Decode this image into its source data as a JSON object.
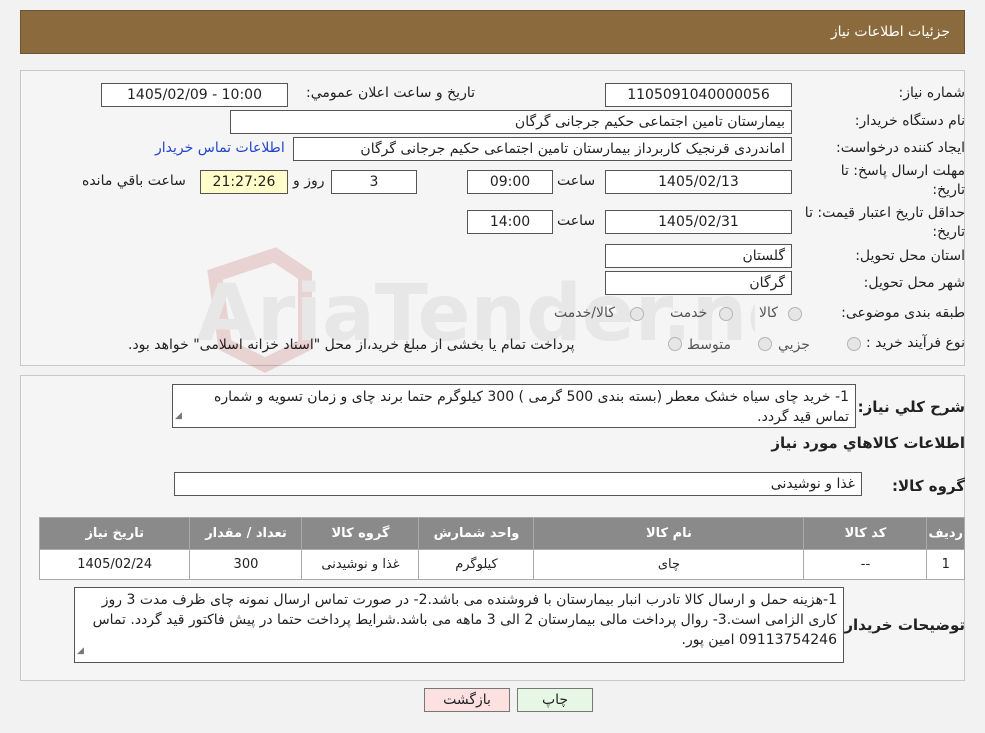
{
  "header": {
    "title": "جزئیات اطلاعات نیاز"
  },
  "watermark": {
    "text": "AriaTender.neT"
  },
  "form": {
    "need_number_label": "شماره نیاز:",
    "need_number": "1105091040000056",
    "announce_label": "تاریخ و ساعت اعلان عمومي:",
    "announce_value": "1405/02/09 - 10:00",
    "buyer_org_label": "نام دستگاه خریدار:",
    "buyer_org": "بیمارستان تامین اجتماعی حکیم جرجانی گرگان",
    "creator_label": "ایجاد کننده درخواست:",
    "creator": "اماندردی قرنجیک کاربرداز بیمارستان تامین اجتماعی حکیم جرجانی گرگان",
    "contact_link": "اطلاعات تماس خریدار",
    "reply_deadline_label_1": "مهلت ارسال پاسخ: تا",
    "reply_deadline_label_2": "تاریخ:",
    "reply_date": "1405/02/13",
    "time_label": "ساعت",
    "reply_time": "09:00",
    "days_value": "3",
    "days_label": "روز و",
    "remaining_time": "21:27:26",
    "remaining_label": "ساعت باقي مانده",
    "price_validity_label_1": "حداقل تاریخ اعتبار قیمت: تا",
    "price_validity_label_2": "تاریخ:",
    "price_date": "1405/02/31",
    "price_time": "14:00",
    "province_label": "استان محل تحویل:",
    "province": "گلستان",
    "city_label": "شهر محل تحویل:",
    "city": "گرگان",
    "category_label": "طبقه بندی موضوعی:",
    "category_options": [
      "کالا",
      "خدمت",
      "کالا/خدمت"
    ],
    "process_label": "نوع فرآیند خرید :",
    "process_options": [
      "جزیي",
      "متوسط"
    ],
    "process_note": "پرداخت تمام یا بخشی از مبلغ خرید،از محل \"اسناد خزانه اسلامی\" خواهد بود."
  },
  "summary": {
    "label": "شرح کلي نیاز:",
    "text": "1- خرید چای سیاه خشک معطر (بسته بندی 500 گرمی )    300 کیلوگرم  حتما برند چای و زمان تسویه و شماره تماس قید گردد.",
    "items_title": "اطلاعات کالاهاي مورد نیاز",
    "group_label": "گروه کالا:",
    "group_value": "غذا و نوشیدنی"
  },
  "table": {
    "headers": [
      "ردیف",
      "کد کالا",
      "نام کالا",
      "واحد شمارش",
      "گروه کالا",
      "تعداد / مقدار",
      "تاریخ نیاز"
    ],
    "rows": [
      [
        "1",
        "--",
        "چای",
        "کیلوگرم",
        "غذا و نوشیدنی",
        "300",
        "1405/02/24"
      ]
    ]
  },
  "buyer_notes": {
    "label": "توضیحات خریدار:",
    "text": "1-هزینه حمل و ارسال کالا تادرب انبار بیمارستان با فروشنده می باشد.2- در صورت تماس ارسال نمونه چای ظرف مدت 3 روز کاری الزامی است.3- روال پرداخت مالی بیمارستان 2 الی 3 ماهه می باشد.شرایط پرداخت حتما در پیش فاکتور قید گردد. تماس 09113754246 امین پور."
  },
  "buttons": {
    "print": "چاپ",
    "back": "بازگشت"
  },
  "colors": {
    "header": "#8b6a3e",
    "back_button": "#fde0e0",
    "print_button": "#e6f7e6",
    "link": "#2244cc"
  }
}
